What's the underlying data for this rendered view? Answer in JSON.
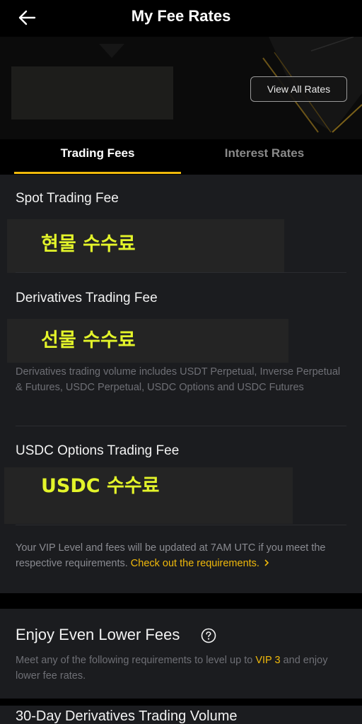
{
  "header": {
    "title": "My Fee Rates",
    "back_icon": "arrow-left-icon"
  },
  "banner": {
    "view_all_label": "View All Rates"
  },
  "tabs": [
    {
      "label": "Trading Fees",
      "active": true
    },
    {
      "label": "Interest Rates",
      "active": false
    }
  ],
  "sections": {
    "spot": {
      "title": "Spot Trading Fee",
      "overlay": "현물 수수료"
    },
    "derivatives": {
      "title": "Derivatives Trading Fee",
      "overlay": "선물 수수료",
      "note": "Derivatives trading volume includes USDT Perpetual, Inverse Perpetual & Futures, USDC Perpetual, USDC Options and USDC Futures"
    },
    "usdc": {
      "title": "USDC Options Trading Fee",
      "overlay": "USDC 수수료"
    }
  },
  "vip_note": {
    "text": "Your VIP Level and fees will be updated at 7AM UTC if you meet the respective requirements. ",
    "link": "Check out the requirements.",
    "link_icon": "chevron-right-icon"
  },
  "lower_fees": {
    "title": "Enjoy Even Lower Fees",
    "help_icon": "question-circle-icon",
    "desc_prefix": "Meet any of the following requirements to level up to ",
    "desc_highlight": "VIP 3",
    "desc_suffix": " and enjoy lower fee rates."
  },
  "volume": {
    "title": "30-Day Derivatives Trading Volume"
  },
  "colors": {
    "accent": "#f0b90b",
    "overlay_text": "#e3f42a",
    "card_bg": "#1b1c1f"
  }
}
